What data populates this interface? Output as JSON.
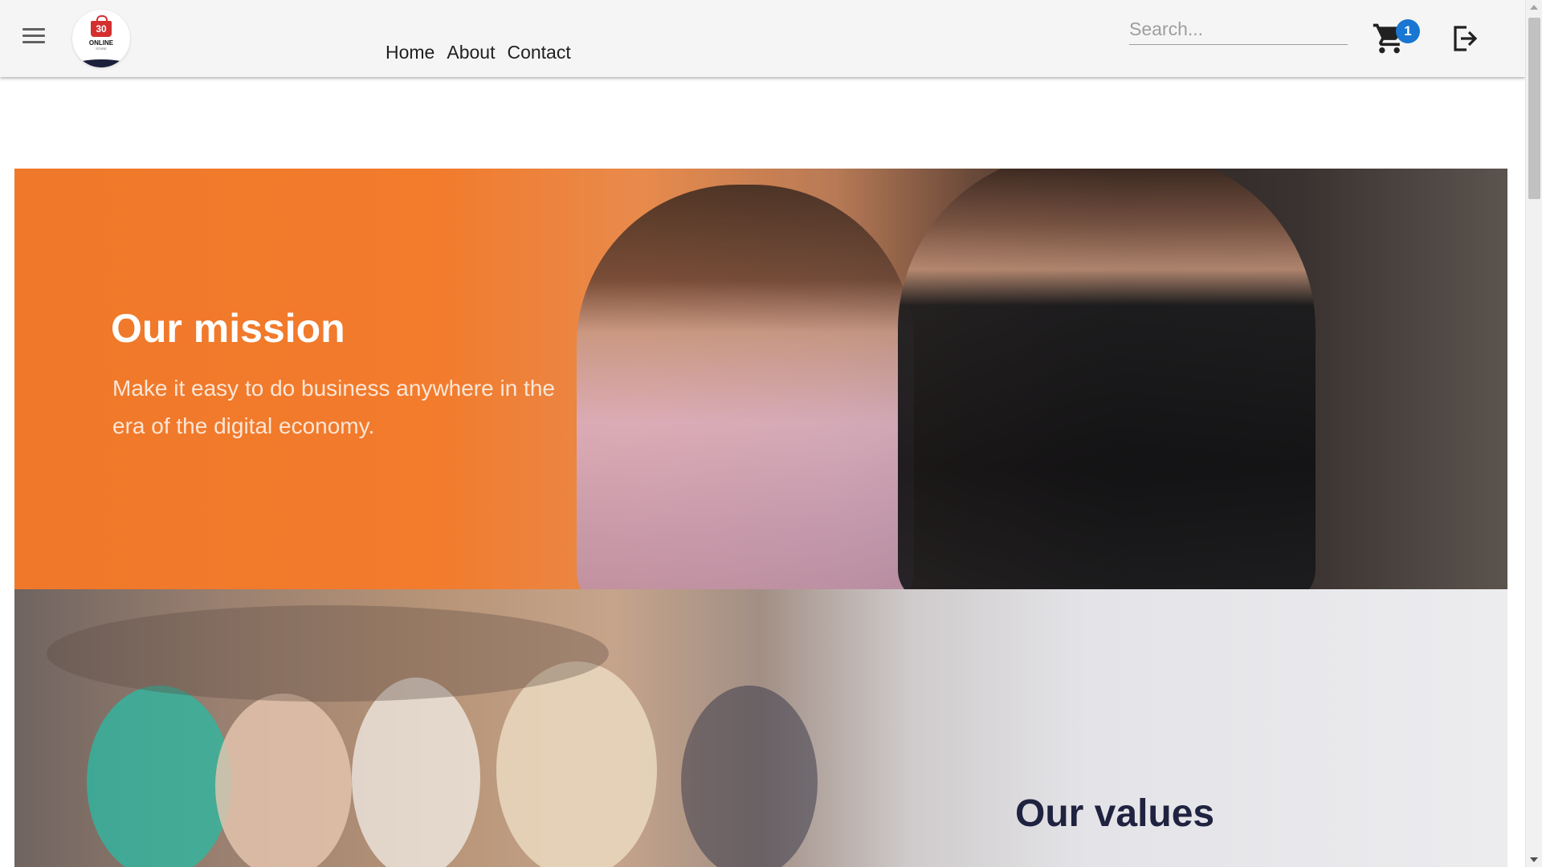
{
  "header": {
    "logo": {
      "number": "30",
      "name": "ONLINE",
      "sub": "STORE"
    },
    "nav": [
      "Home",
      "About",
      "Contact"
    ],
    "search": {
      "placeholder": "Search...",
      "value": ""
    },
    "cart": {
      "count": "1",
      "icon": "cart-icon"
    },
    "icons": {
      "menu": "menu-icon",
      "logout": "logout-icon"
    },
    "colors": {
      "badge": "#1976d2",
      "bar": "#f5f5f5"
    }
  },
  "mission": {
    "title": "Our mission",
    "text": "Make it easy to do business anywhere in the era of the digital economy.",
    "accent": "#f27b2c"
  },
  "values": {
    "title": "Our values",
    "title_color": "#1f2340"
  }
}
